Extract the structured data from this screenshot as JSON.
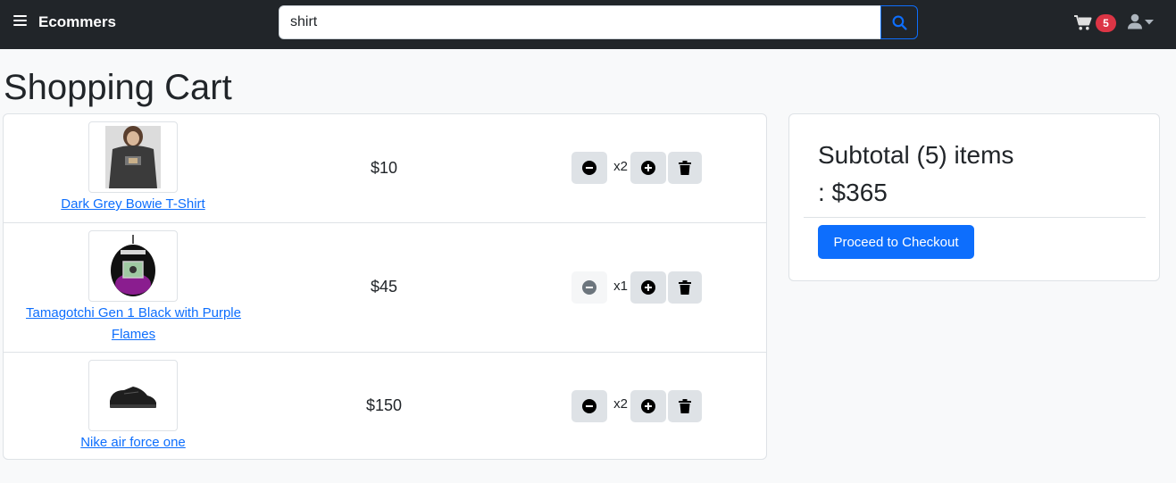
{
  "navbar": {
    "brand": "Ecommers",
    "search_value": "shirt",
    "cart_count": "5"
  },
  "page_title": "Shopping Cart",
  "cart_items": [
    {
      "name": "Dark Grey Bowie T-Shirt",
      "price": "$10",
      "qty": "x2",
      "image": "t-shirt-photo"
    },
    {
      "name": "Tamagotchi Gen 1 Black with Purple Flames",
      "price": "$45",
      "qty": "x1",
      "image": "tamagotchi-photo"
    },
    {
      "name": "Nike air force one",
      "price": "$150",
      "qty": "x2",
      "image": "sneaker-photo"
    }
  ],
  "summary": {
    "subtotal_label": "Subtotal (5) items",
    "subtotal_amount": ": $365",
    "checkout_label": "Proceed to Checkout"
  },
  "colors": {
    "navbar": "#212529",
    "primary": "#0d6efd",
    "badge": "#dc3545",
    "background": "#f8f9fa"
  }
}
